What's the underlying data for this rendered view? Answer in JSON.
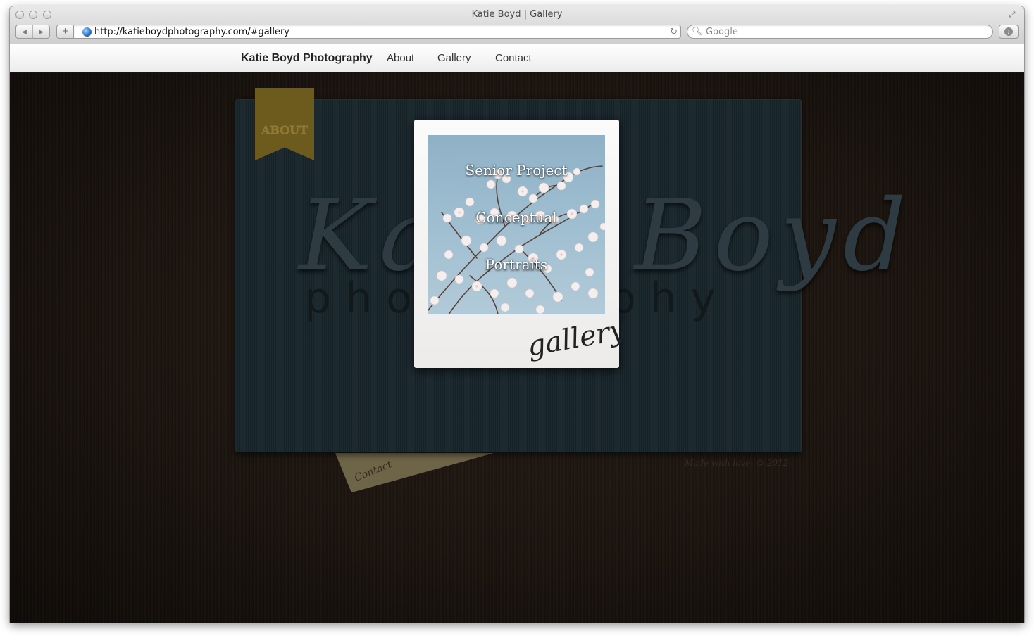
{
  "window": {
    "title": "Katie Boyd | Gallery"
  },
  "browser": {
    "url": "http://katieboydphotography.com/#gallery",
    "search_placeholder": "Google"
  },
  "site_nav": {
    "brand": "Katie Boyd Photography",
    "links": [
      "About",
      "Gallery",
      "Contact"
    ]
  },
  "hero": {
    "ribbon_label": "ABOUT",
    "logo_script": "Katie Boyd",
    "logo_sub": "photography"
  },
  "polaroid": {
    "items": [
      "Senior Project",
      "Conceptual",
      "Portraits"
    ],
    "caption": "gallery"
  },
  "contact_tab": {
    "label": "Contact"
  },
  "footer": {
    "note": "Made with love. © 2012."
  },
  "icons": {
    "back": "back-arrow-icon",
    "forward": "forward-arrow-icon",
    "add": "plus-icon",
    "site": "globe-icon",
    "reload": "reload-icon",
    "search": "magnifier-icon",
    "downloads": "downloads-icon",
    "fullscreen": "fullscreen-icon"
  },
  "colors": {
    "page_bg": "#1b140f",
    "panel": "#18262c",
    "ribbon": "#6d5a1d",
    "sky": "#9dbdd0"
  }
}
